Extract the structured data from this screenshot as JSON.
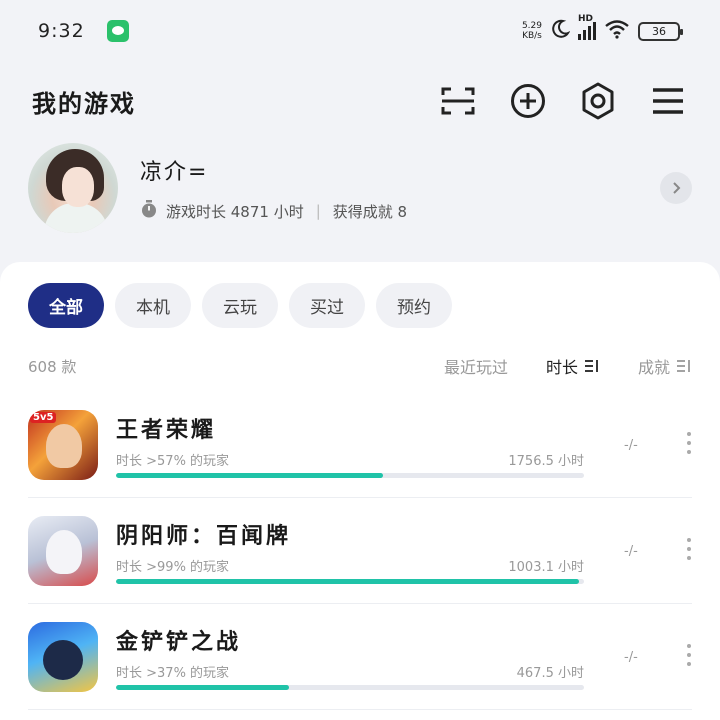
{
  "status_bar": {
    "time": "9:32",
    "net_speed_value": "5.29",
    "net_speed_unit": "KB/s",
    "hd_label": "HD",
    "battery": "36"
  },
  "header": {
    "title": "我的游戏"
  },
  "profile": {
    "username": "凉介=",
    "playtime_label": "游戏时长 4871 小时",
    "achievements_label": "获得成就 8"
  },
  "filters": [
    {
      "label": "全部",
      "active": true
    },
    {
      "label": "本机",
      "active": false
    },
    {
      "label": "云玩",
      "active": false
    },
    {
      "label": "买过",
      "active": false
    },
    {
      "label": "预约",
      "active": false
    }
  ],
  "list_meta": {
    "count": "608 款",
    "sort_recent": "最近玩过",
    "sort_duration": "时长",
    "sort_achievement": "成就"
  },
  "games": [
    {
      "name": "王者荣耀",
      "badge": "5v5",
      "percentile": "时长 >57% 的玩家",
      "hours": "1756.5 小时",
      "achievement": "-/-",
      "progress": 0.57
    },
    {
      "name": "阴阳师：百闻牌",
      "badge": "",
      "percentile": "时长 >99% 的玩家",
      "hours": "1003.1 小时",
      "achievement": "-/-",
      "progress": 0.99
    },
    {
      "name": "金铲铲之战",
      "badge": "",
      "percentile": "时长 >37% 的玩家",
      "hours": "467.5 小时",
      "achievement": "-/-",
      "progress": 0.37
    }
  ],
  "colors": {
    "accent": "#1f2e86",
    "progress": "#20c3a8",
    "background": "#f2f3f7"
  }
}
